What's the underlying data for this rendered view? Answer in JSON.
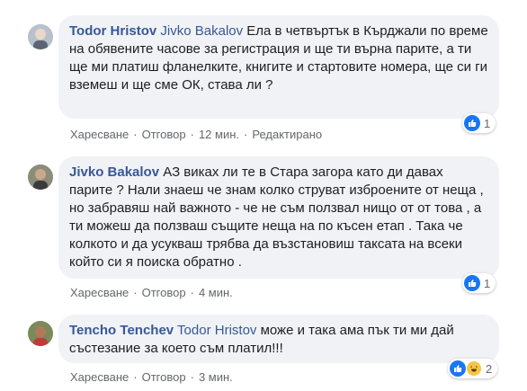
{
  "comments": [
    {
      "author": "Todor Hristov",
      "tag": "Jivko Bakalov",
      "text": " Ела в четвъртък в Кърджали по време на обявените часове за регистрация и ще ти върна парите, а ти ще ми платиш фланелките, книгите и стартовите номера, ще си ги вземеш и ще сме ОК, става ли ?",
      "actions": {
        "like": "Харесване",
        "reply": "Отговор",
        "time": "12 мин.",
        "edit": "Редактирано"
      },
      "reaction_count": "1",
      "reactions": [
        "like-icon"
      ]
    },
    {
      "author": "Jivko Bakalov",
      "tag": "",
      "text": " АЗ виках ли те в Стара загора като ди давах парите ? Нали знаеш че знам колко струват изброените от неща , но забравяш най важното - че не съм ползвал нищо от от това , а ти можеш да ползваш същите неща на по късен етап . Така че колкото и да усукваш трябва да възстановиш таксата на всеки който си я поиска обратно .",
      "actions": {
        "like": "Харесване",
        "reply": "Отговор",
        "time": "4 мин."
      },
      "reaction_count": "1",
      "reactions": [
        "like-icon"
      ]
    },
    {
      "author": "Tencho Tenchev",
      "tag": "Todor Hristov",
      "text": " може и така ама пък ти ми дай състезание за което съм платил!!!",
      "actions": {
        "like": "Харесване",
        "reply": "Отговор",
        "time": "3 мин."
      },
      "reaction_count": "2",
      "reactions": [
        "like-icon",
        "haha-icon"
      ]
    }
  ],
  "colors": {
    "bubble": "#f0f2f5",
    "name": "#385898",
    "meta": "#65676b",
    "like": "#1877f2",
    "haha": "#f7c544"
  }
}
